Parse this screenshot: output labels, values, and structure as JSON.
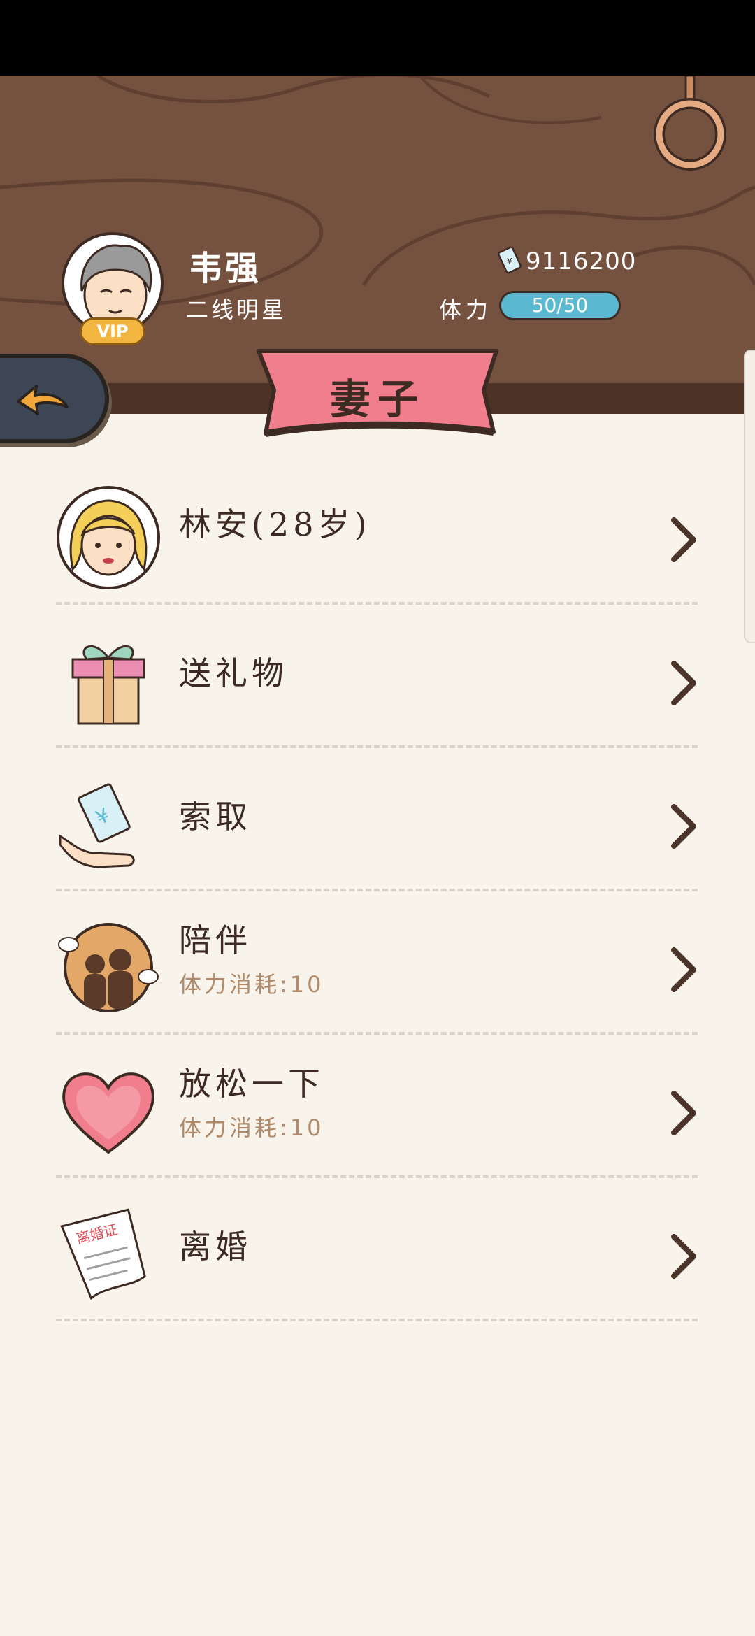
{
  "player": {
    "name": "韦强",
    "title": "二线明星",
    "vip_label": "VIP",
    "money": "9116200",
    "stamina_label": "体力",
    "stamina_text": "50/50",
    "stamina_fraction": 1.0
  },
  "page": {
    "title": "妻子"
  },
  "menu": {
    "items": [
      {
        "label": "林安(28岁)",
        "icon": "wife-portrait-icon"
      },
      {
        "label": "送礼物",
        "icon": "gift-icon"
      },
      {
        "label": "索取",
        "icon": "money-hand-icon"
      },
      {
        "label": "陪伴",
        "sub": "体力消耗:10",
        "icon": "couple-icon"
      },
      {
        "label": "放松一下",
        "sub": "体力消耗:10",
        "icon": "heart-icon"
      },
      {
        "label": "离婚",
        "icon": "divorce-certificate-icon",
        "certificate_text": "离婚证"
      }
    ]
  },
  "colors": {
    "header_wood": "#75513f",
    "ribbon_pink": "#f07e8c",
    "stamina_blue": "#5ab8d0",
    "vip_gold": "#f2b540",
    "back_button": "#3c4655",
    "arrow_orange": "#f0a63a"
  }
}
